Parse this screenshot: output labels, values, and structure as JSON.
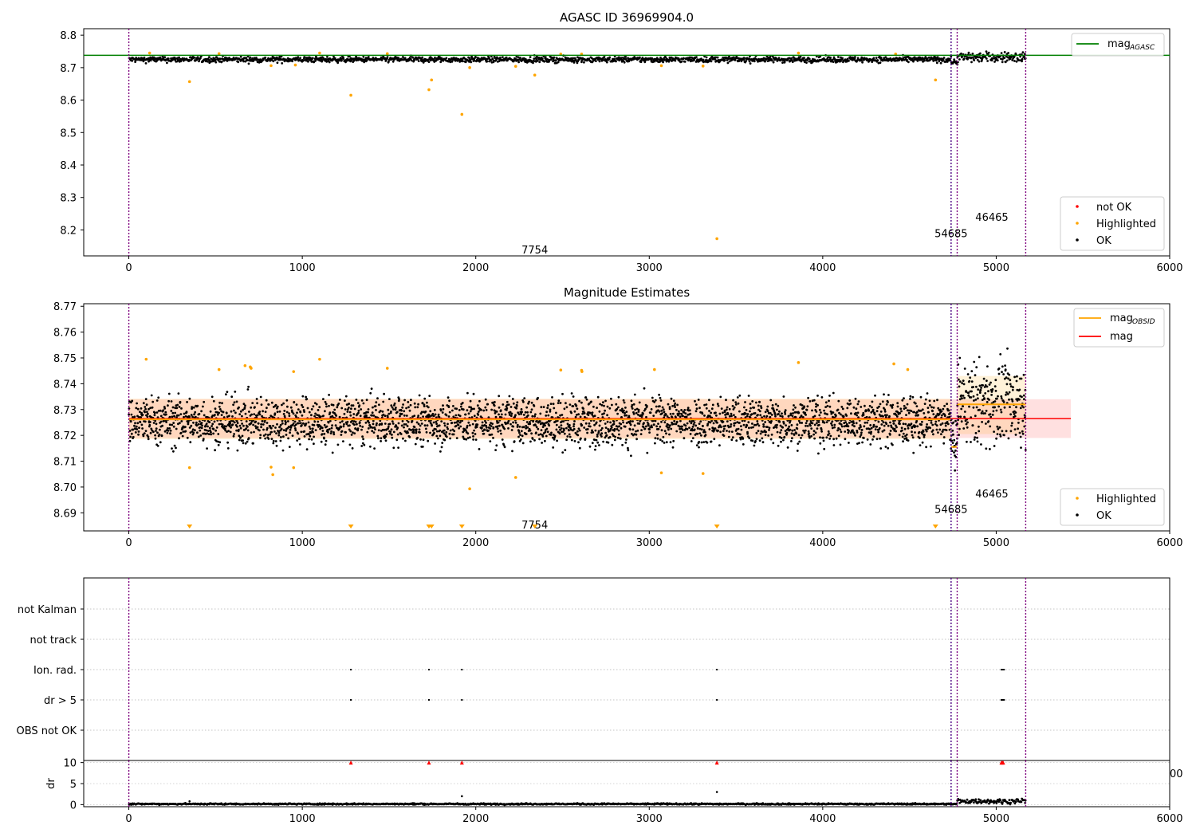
{
  "chart_data": [
    {
      "type": "scatter",
      "title": "AGASC ID 36969904.0",
      "xlim": [
        -260,
        6000
      ],
      "ylim": [
        8.12,
        8.82
      ],
      "xticks": [
        0,
        1000,
        2000,
        3000,
        4000,
        5000,
        6000
      ],
      "yticks": [
        8.2,
        8.3,
        8.4,
        8.5,
        8.6,
        8.7,
        8.8
      ],
      "line_legend": [
        {
          "name": "mag",
          "sub": "AGASC",
          "color": "#008000"
        }
      ],
      "point_legend": [
        {
          "name": "not OK",
          "color": "#ff0000"
        },
        {
          "name": "Highlighted",
          "color": "#ffa500"
        },
        {
          "name": "OK",
          "color": "#000000"
        }
      ],
      "legend_position": [
        "upper right",
        "lower right"
      ],
      "mag_agasc": 8.738,
      "obs_boundaries": [
        0,
        4740,
        4775,
        5170
      ],
      "obsid_labels": [
        {
          "text": "7754",
          "x": 2340,
          "y": 8.14
        },
        {
          "text": "54685",
          "x": 4740,
          "y": 8.19
        },
        {
          "text": "46465",
          "x": 4975,
          "y": 8.24
        }
      ],
      "highlighted_points": [
        [
          350,
          8.657
        ],
        [
          1280,
          8.615
        ],
        [
          1730,
          8.632
        ],
        [
          1745,
          8.662
        ],
        [
          1920,
          8.556
        ],
        [
          1965,
          8.7
        ],
        [
          2340,
          8.677
        ],
        [
          3390,
          8.173
        ],
        [
          4650,
          8.662
        ],
        [
          820,
          8.706
        ],
        [
          2230,
          8.704
        ],
        [
          3310,
          8.705
        ],
        [
          960,
          8.708
        ],
        [
          3070,
          8.706
        ],
        [
          120,
          8.745
        ],
        [
          520,
          8.743
        ],
        [
          1100,
          8.745
        ],
        [
          1490,
          8.743
        ],
        [
          2490,
          8.742
        ],
        [
          2610,
          8.742
        ],
        [
          3860,
          8.745
        ],
        [
          4420,
          8.742
        ]
      ],
      "ok_series_band": [
        {
          "x0": 0,
          "x1": 4740,
          "center": 8.725,
          "spread": 0.008
        },
        {
          "x0": 4740,
          "x1": 4775,
          "center": 8.718,
          "spread": 0.008
        },
        {
          "x0": 4775,
          "x1": 5170,
          "center": 8.732,
          "spread": 0.014
        }
      ]
    },
    {
      "type": "scatter",
      "title": "Magnitude Estimates",
      "xlim": [
        -260,
        6000
      ],
      "ylim": [
        8.683,
        8.771
      ],
      "xticks": [
        0,
        1000,
        2000,
        3000,
        4000,
        5000,
        6000
      ],
      "yticks": [
        8.69,
        8.7,
        8.71,
        8.72,
        8.73,
        8.74,
        8.75,
        8.76,
        8.77
      ],
      "line_legend": [
        {
          "name": "mag",
          "sub": "OBSID",
          "color": "#ffa500"
        },
        {
          "name": "mag",
          "sub": "",
          "color": "#ff0000"
        }
      ],
      "point_legend": [
        {
          "name": "Highlighted",
          "color": "#ffa500"
        },
        {
          "name": "OK",
          "color": "#000000"
        }
      ],
      "legend_position": [
        "upper right",
        "lower right"
      ],
      "mag": 8.7265,
      "mag_band": [
        8.719,
        8.734
      ],
      "mag_extent": [
        0,
        5430
      ],
      "obsid_mags": [
        {
          "x0": 0,
          "x1": 4740,
          "mag": 8.7262,
          "lo": 8.7185,
          "hi": 8.7342
        },
        {
          "x0": 4740,
          "x1": 4775,
          "mag": 8.7155,
          "lo": 8.7155,
          "hi": 8.7155
        },
        {
          "x0": 4775,
          "x1": 5170,
          "mag": 8.732,
          "lo": 8.7205,
          "hi": 8.743
        }
      ],
      "obs_boundaries": [
        0,
        4740,
        4775,
        5170
      ],
      "obsid_labels": [
        {
          "text": "7754",
          "x": 2340,
          "y": 8.6855
        },
        {
          "text": "54685",
          "x": 4740,
          "y": 8.6915
        },
        {
          "text": "46465",
          "x": 4975,
          "y": 8.6975
        }
      ],
      "highlighted_points": [
        [
          100,
          8.7495
        ],
        [
          520,
          8.7455
        ],
        [
          670,
          8.747
        ],
        [
          700,
          8.7465
        ],
        [
          705,
          8.746
        ],
        [
          950,
          8.7447
        ],
        [
          1100,
          8.7495
        ],
        [
          1490,
          8.746
        ],
        [
          2490,
          8.7453
        ],
        [
          2610,
          8.7452
        ],
        [
          2612,
          8.7447
        ],
        [
          3030,
          8.7455
        ],
        [
          3860,
          8.7482
        ],
        [
          4410,
          8.7477
        ],
        [
          4490,
          8.7455
        ],
        [
          350,
          8.7075
        ],
        [
          820,
          8.7077
        ],
        [
          830,
          8.7048
        ],
        [
          950,
          8.7075
        ],
        [
          1965,
          8.6993
        ],
        [
          2230,
          8.7037
        ],
        [
          3070,
          8.7055
        ],
        [
          3310,
          8.7052
        ]
      ],
      "off_scale_markers": [
        350,
        1280,
        1730,
        1745,
        1920,
        2340,
        3390,
        4650
      ],
      "ok_series_band": [
        {
          "x0": 0,
          "x1": 4740,
          "center": 8.7255,
          "spread": 0.0085
        },
        {
          "x0": 4740,
          "x1": 4775,
          "center": 8.7165,
          "spread": 0.008
        },
        {
          "x0": 4775,
          "x1": 5170,
          "center": 8.7325,
          "spread": 0.0145
        }
      ]
    },
    {
      "type": "scatter",
      "title": "",
      "xlim": [
        -260,
        6000
      ],
      "categories": [
        "not Kalman",
        "not track",
        "Ion. rad.",
        "dr > 5",
        "OBS not OK"
      ],
      "flag_points": {
        "Ion. rad.": [
          1280,
          1730,
          1920,
          3390,
          5030,
          5035,
          5040,
          5045
        ],
        "dr > 5": [
          1280,
          1730,
          1920,
          3390,
          5030,
          5035,
          5040,
          5045
        ]
      },
      "obs_boundaries": [
        0,
        4740,
        4775,
        5170
      ]
    },
    {
      "type": "scatter",
      "title": "",
      "xlim": [
        -260,
        6000
      ],
      "ylim": [
        -0.5,
        10.5
      ],
      "ylabel": "dr",
      "xticks": [
        0,
        1000,
        2000,
        3000,
        4000,
        5000,
        6000
      ],
      "yticks": [
        0,
        5,
        10
      ],
      "clipped_tick_fragment": "00",
      "high_dr_markers": [
        1280,
        1730,
        1920,
        3390,
        5030,
        5035,
        5040
      ],
      "outliers": [
        [
          350,
          0.8
        ],
        [
          1920,
          2.0
        ],
        [
          3390,
          3.0
        ]
      ],
      "ok_series_band": [
        {
          "x0": 0,
          "x1": 4775,
          "center": 0.15,
          "spread": 0.15
        },
        {
          "x0": 4775,
          "x1": 5170,
          "center": 0.8,
          "spread": 0.5
        }
      ],
      "obs_boundaries": [
        0,
        4740,
        4775,
        5170
      ]
    }
  ]
}
